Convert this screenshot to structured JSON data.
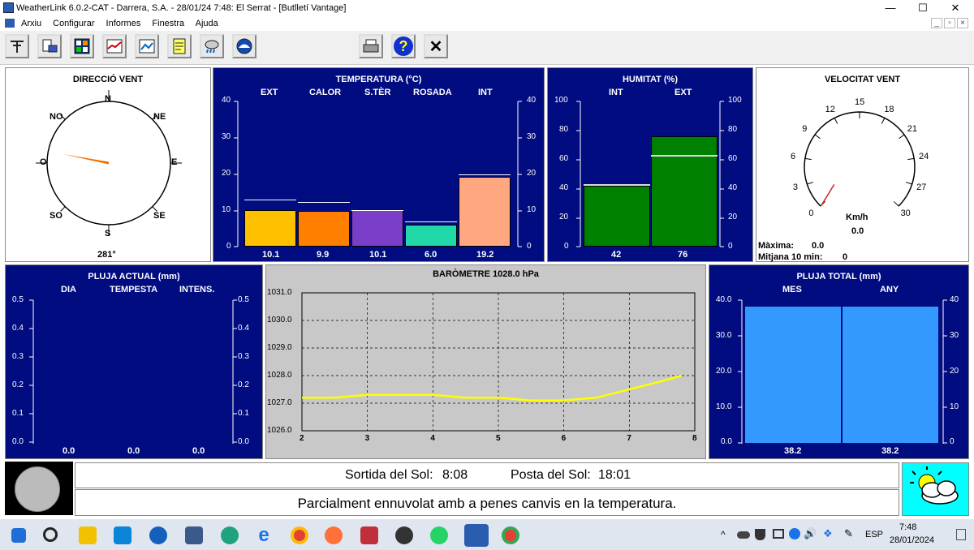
{
  "window": {
    "title": "WeatherLink 6.0.2-CAT  -  Darrera, S.A.  -  28/01/24  7:48: El Serrat - [Butlletí Vantage]"
  },
  "window_controls": {
    "minimize": "—",
    "maximize": "☐",
    "close": "✕",
    "mdi_min": "_",
    "mdi_restore": "▫",
    "mdi_close": "×"
  },
  "menu": {
    "items": [
      "Arxiu",
      "Configurar",
      "Informes",
      "Finestra",
      "Ajuda"
    ]
  },
  "toolbar": {
    "help": "?",
    "close": "✕"
  },
  "wind_dir": {
    "title": "DIRECCIÓ VENT",
    "labels": {
      "n": "N",
      "ne": "NE",
      "e": "E",
      "se": "SE",
      "s": "S",
      "so": "SO",
      "o": "O",
      "no": "NO"
    },
    "value": "281°",
    "degrees": 281
  },
  "temperature": {
    "title": "TEMPERATURA  (°C)",
    "columns": [
      "EXT",
      "CALOR",
      "S.TÈR",
      "ROSADA",
      "INT"
    ],
    "values": [
      "10.1",
      "9.9",
      "10.1",
      "6.0",
      "19.2"
    ],
    "highs": [
      13,
      12.4,
      10,
      7,
      20
    ],
    "colors": [
      "#ffc000",
      "#ff8000",
      "#7a3ec8",
      "#20d8a8",
      "#ffa880"
    ],
    "ticks": [
      "40",
      "30",
      "20",
      "10",
      "0"
    ],
    "max": 40
  },
  "humidity": {
    "title": "HUMITAT  (%)",
    "columns": [
      "INT",
      "EXT"
    ],
    "values": [
      "42",
      "76"
    ],
    "highs": [
      43,
      63
    ],
    "ticks": [
      "100",
      "80",
      "60",
      "40",
      "20",
      "0"
    ],
    "color": "#008000"
  },
  "wind_speed": {
    "title": "VELOCITAT VENT",
    "ticks": [
      "0",
      "3",
      "6",
      "9",
      "12",
      "15",
      "18",
      "21",
      "24",
      "27",
      "30"
    ],
    "unit": "Km/h",
    "value": "0.0",
    "max_label": "Màxima:",
    "max_value": "0.0",
    "avg_label": "Mitjana 10 min:",
    "avg_value": "0"
  },
  "rain_current": {
    "title": "PLUJA ACTUAL  (mm)",
    "columns": [
      "DIA",
      "TEMPESTA",
      "INTENS."
    ],
    "values": [
      "0.0",
      "0.0",
      "0.0"
    ],
    "ticks": [
      "0.5",
      "0.4",
      "0.3",
      "0.2",
      "0.1",
      "0.0"
    ]
  },
  "barometer": {
    "title": "BARÒMETRE 1028.0 hPa",
    "yticks": [
      "1031.0",
      "1030.0",
      "1029.0",
      "1028.0",
      "1027.0",
      "1026.0"
    ],
    "xticks": [
      "2",
      "3",
      "4",
      "5",
      "6",
      "7",
      "8"
    ]
  },
  "chart_data": {
    "type": "line",
    "title": "BARÒMETRE 1028.0 hPa",
    "x": [
      2,
      2.5,
      3,
      3.5,
      4,
      4.5,
      5,
      5.5,
      6,
      6.5,
      7,
      7.5,
      7.8
    ],
    "values": [
      1027.2,
      1027.2,
      1027.3,
      1027.3,
      1027.3,
      1027.2,
      1027.2,
      1027.1,
      1027.1,
      1027.2,
      1027.5,
      1027.8,
      1028.0
    ],
    "xlim": [
      2,
      8
    ],
    "ylim": [
      1026,
      1031
    ],
    "grid": true,
    "color": "#ffff00"
  },
  "rain_total": {
    "title": "PLUJA TOTAL  (mm)",
    "columns": [
      "MES",
      "ANY"
    ],
    "values": [
      "38.2",
      "38.2"
    ],
    "left_ticks": [
      "40.0",
      "30.0",
      "20.0",
      "10.0",
      "0.0"
    ],
    "right_ticks": [
      "40",
      "30",
      "20",
      "10",
      "0"
    ],
    "color": "#3399ff"
  },
  "sun": {
    "rise_label": "Sortida del Sol:",
    "rise": "8:08",
    "set_label": "Posta del Sol:",
    "set": "18:01"
  },
  "forecast": {
    "text": "Parcialment ennuvolat amb a penes canvis en la temperatura."
  },
  "taskbar": {
    "lang": "ESP",
    "time": "7:48",
    "date": "28/01/2024"
  }
}
